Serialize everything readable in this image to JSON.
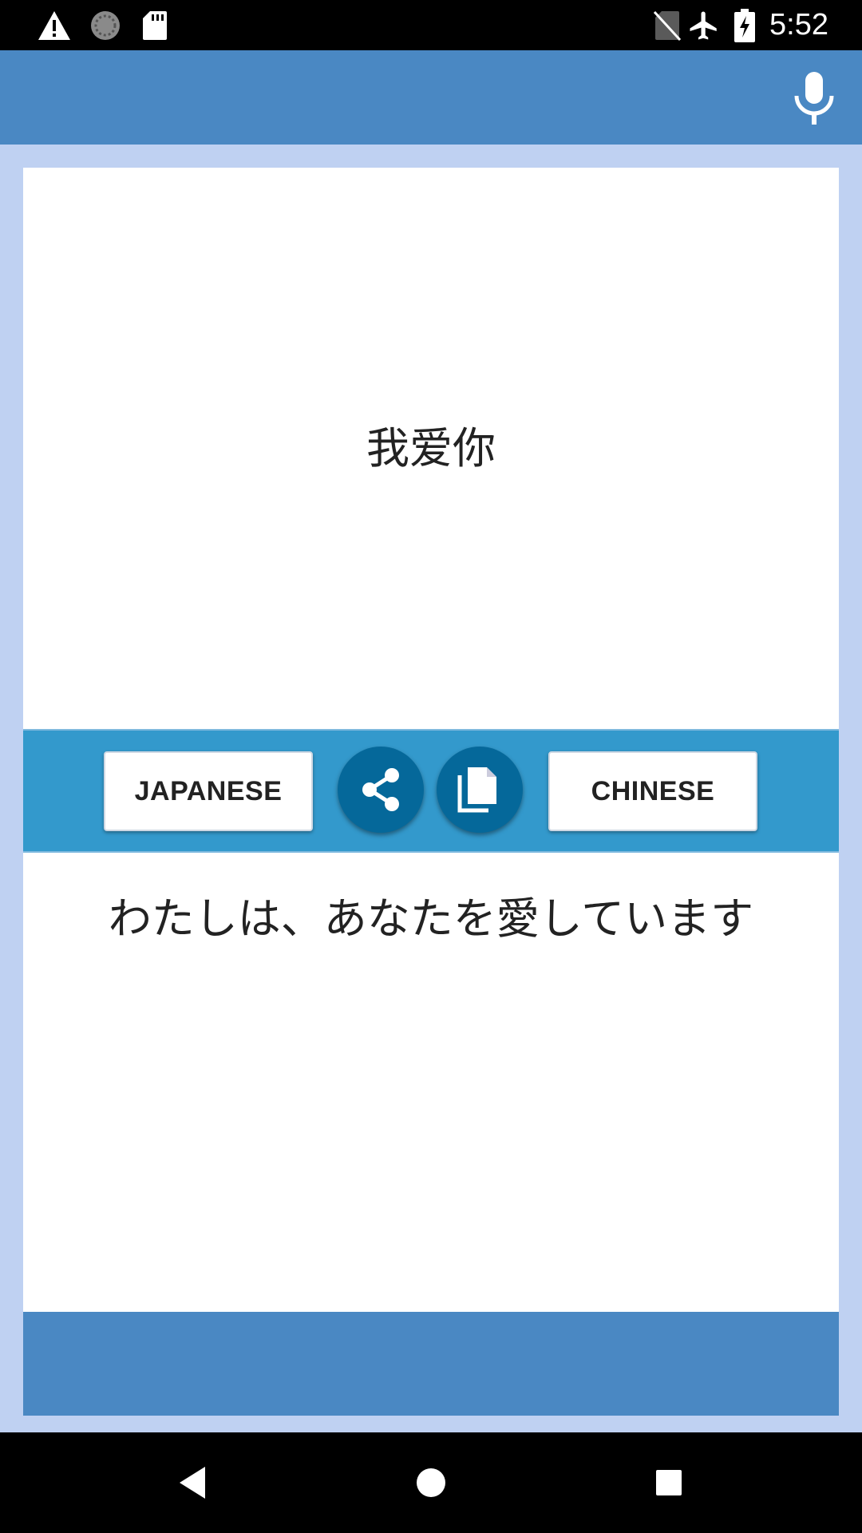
{
  "status_bar": {
    "time": "5:52",
    "icons": [
      "warning-icon",
      "sync-circle-icon",
      "sd-card-icon",
      "no-sim-icon",
      "airplane-icon",
      "battery-charging-icon"
    ]
  },
  "app_bar": {
    "mic_icon": "microphone-icon"
  },
  "source": {
    "text": "我爱你"
  },
  "controls": {
    "left_language": "JAPANESE",
    "right_language": "CHINESE",
    "share_icon": "share-icon",
    "copy_icon": "copy-icon"
  },
  "target": {
    "text": "わたしは、あなたを愛しています"
  },
  "colors": {
    "app_bar": "#4a88c3",
    "background": "#bfd1f2",
    "controls_bar": "#3399cc",
    "round_button": "#05689a"
  },
  "nav_bar": {
    "icons": [
      "back-icon",
      "home-icon",
      "recents-icon"
    ]
  }
}
